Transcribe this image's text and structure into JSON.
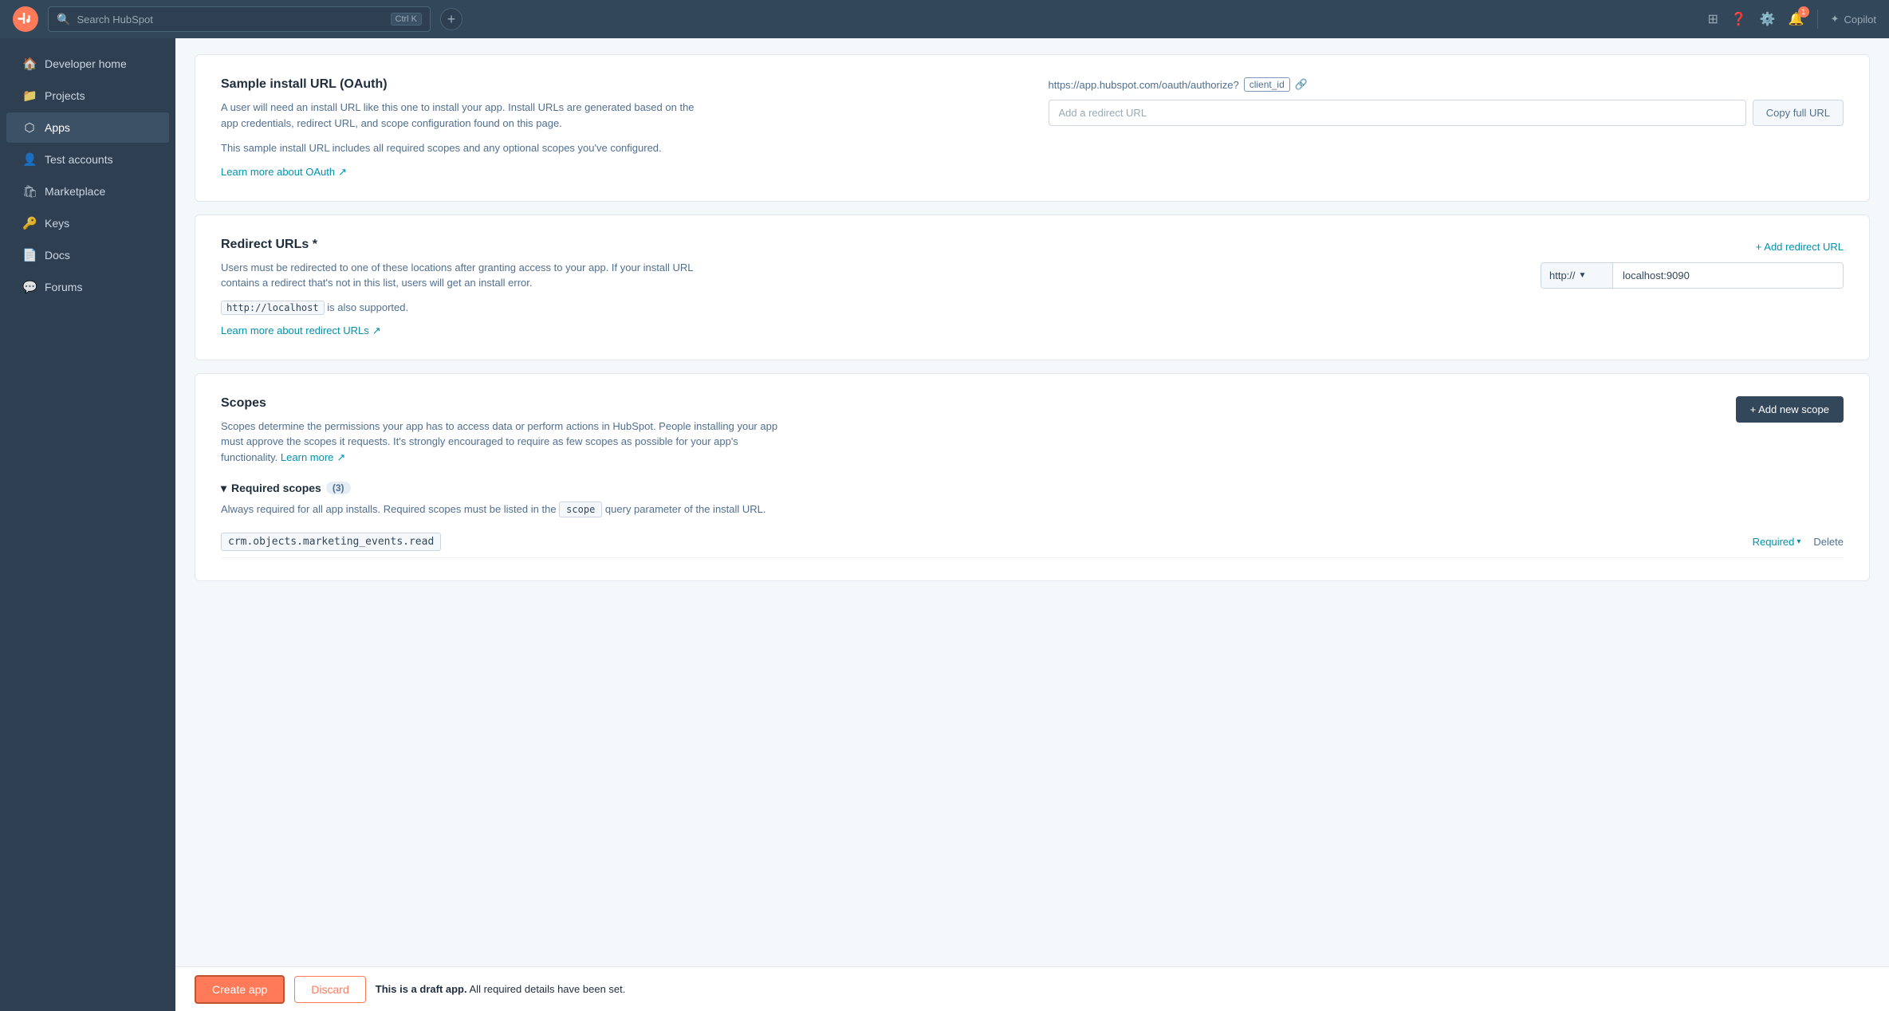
{
  "topnav": {
    "search_placeholder": "Search HubSpot",
    "keyboard_shortcut": "Ctrl K",
    "copilot_label": "Copilot"
  },
  "sidebar": {
    "items": [
      {
        "id": "developer-home",
        "label": "Developer home",
        "icon": "🏠"
      },
      {
        "id": "projects",
        "label": "Projects",
        "icon": "📁"
      },
      {
        "id": "apps",
        "label": "Apps",
        "icon": "⬡",
        "active": true
      },
      {
        "id": "test-accounts",
        "label": "Test accounts",
        "icon": "👤"
      },
      {
        "id": "marketplace",
        "label": "Marketplace",
        "icon": "🛍"
      },
      {
        "id": "keys",
        "label": "Keys",
        "icon": "🔑"
      },
      {
        "id": "docs",
        "label": "Docs",
        "icon": "📄"
      },
      {
        "id": "forums",
        "label": "Forums",
        "icon": "💬"
      }
    ]
  },
  "sections": {
    "sample_install_url": {
      "title": "Sample install URL (OAuth)",
      "desc1": "A user will need an install URL like this one to install your app. Install URLs are generated based on the app credentials, redirect URL, and scope configuration found on this page.",
      "desc2": "This sample install URL includes all required scopes and any optional scopes you've configured.",
      "oauth_url_prefix": "https://app.hubspot.com/oauth/authorize?",
      "client_id_label": "client_id",
      "redirect_input_placeholder": "Add a redirect URL",
      "copy_btn_label": "Copy full URL",
      "learn_more_label": "Learn more about OAuth",
      "link_icon": "↗"
    },
    "redirect_urls": {
      "title": "Redirect URLs *",
      "desc": "Users must be redirected to one of these locations after granting access to your app. If your install URL contains a redirect that's not in this list, users will get an install error.",
      "localhost_note": "http://localhost",
      "localhost_suffix": " is also supported.",
      "add_redirect_label": "+ Add redirect URL",
      "protocol_value": "http://",
      "url_value": "localhost:9090",
      "learn_more_label": "Learn more about redirect URLs",
      "link_icon": "↗"
    },
    "scopes": {
      "title": "Scopes",
      "desc": "Scopes determine the permissions your app has to access data or perform actions in HubSpot. People installing your app must approve the scopes it requests. It's strongly encouraged to require as few scopes as possible for your app's functionality.",
      "learn_more_label": "Learn more",
      "link_icon": "↗",
      "add_scope_label": "+ Add new scope",
      "required_scopes_label": "Required scopes",
      "required_scopes_count": "(3)",
      "required_scopes_desc_prefix": "Always required for all app installs. Required scopes must be listed in the ",
      "scope_param_label": "scope",
      "required_scopes_desc_suffix": " query parameter of the install URL.",
      "scope_item": {
        "name": "crm.objects.marketing_events.read",
        "action": "Required",
        "delete_label": "Delete"
      }
    }
  },
  "bottom_bar": {
    "create_label": "Create app",
    "discard_label": "Discard",
    "notice_bold": "This is a draft app.",
    "notice_text": " All required details have been set."
  }
}
